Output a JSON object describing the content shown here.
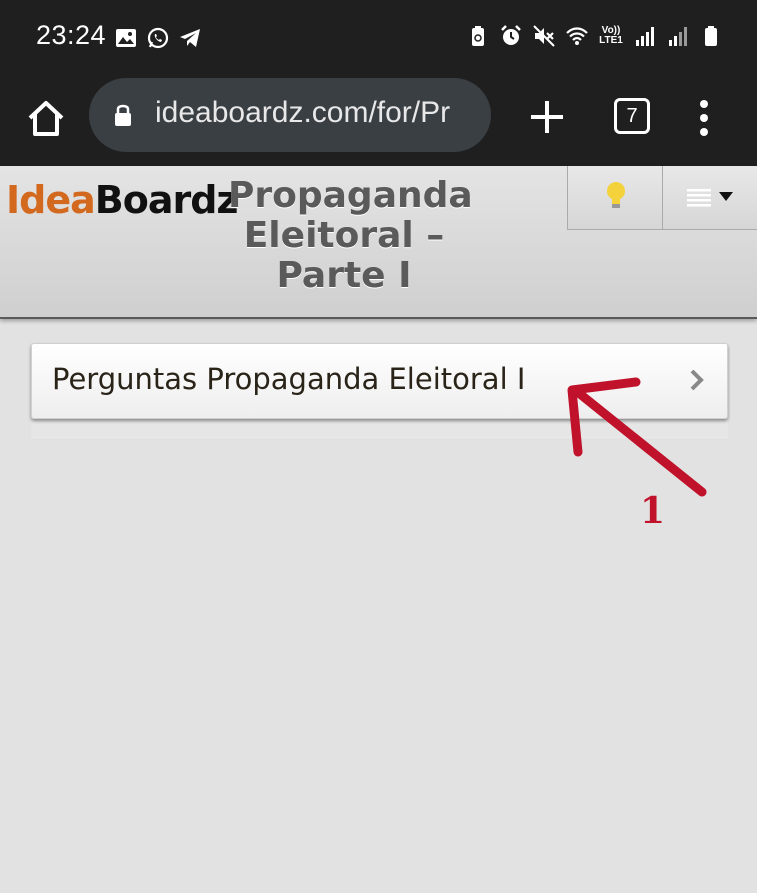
{
  "status": {
    "time": "23:24",
    "volte_top": "Vo))",
    "volte_bottom": "LTE1"
  },
  "browser": {
    "url": "ideaboardz.com/for/Pr",
    "tab_count": "7"
  },
  "app": {
    "logo_idea": "Idea",
    "logo_boardz": "Boardz",
    "board_title": "Propaganda Eleitoral – Parte I"
  },
  "sections": [
    {
      "label": "Perguntas Propaganda Eleitoral I"
    }
  ],
  "annotation": {
    "number": "1",
    "color": "#c0122b"
  },
  "icons": {
    "status_left": [
      "gallery-icon",
      "whatsapp-icon",
      "telegram-icon"
    ],
    "status_right": [
      "battery-saver-icon",
      "alarm-icon",
      "mute-icon",
      "wifi-icon",
      "signal-icon",
      "signal-icon",
      "battery-icon"
    ],
    "header": [
      "lightbulb-icon",
      "list-menu-icon"
    ]
  }
}
